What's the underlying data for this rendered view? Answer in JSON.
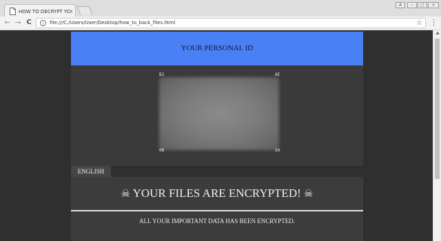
{
  "browser": {
    "tab_title": "HOW TO DECRYPT YOUR F",
    "tab_close": "×",
    "url": "file:///C:/Users/User/Desktop/how_to_back_files.html",
    "nav": {
      "back": "←",
      "forward": "→",
      "reload": "C",
      "star": "☆",
      "menu": "⋮",
      "info": "i"
    },
    "window_controls": [
      "A",
      "–",
      "□",
      "×"
    ]
  },
  "page": {
    "id_header": "YOUR PERSONAL ID",
    "corners": {
      "top_left": "B2",
      "top_right": "AE",
      "bottom_left": "0B",
      "bottom_right": "2A"
    },
    "language_tab": "ENGLISH",
    "headline": "YOUR FILES ARE ENCRYPTED!",
    "skull_glyph": "☠",
    "subline": "ALL YOUR IMPORTANT DATA HAS BEEN ENCRYPTED."
  },
  "colors": {
    "header_blue": "#4a80f5",
    "page_background": "#2f2f2f",
    "panel": "#3a3a3a"
  }
}
